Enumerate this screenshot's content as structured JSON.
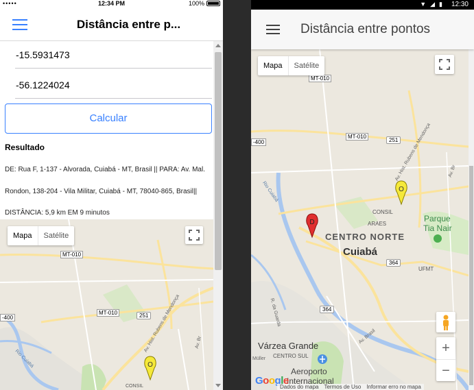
{
  "ios": {
    "status": {
      "carrier": "•••••",
      "time": "12:34 PM",
      "battery": "100%"
    },
    "header": {
      "title": "Distância entre p..."
    },
    "fields": {
      "latitude": "-15.5931473",
      "longitude": "-56.1224024"
    },
    "button": {
      "calculate": "Calcular"
    },
    "result": {
      "title": "Resultado",
      "text": "DE: Rua F, 1-137 - Alvorada, Cuiabá - MT, Brasil || PARA: Av. Mal. Rondon, 138-204 - Vila Militar, Cuiabá - MT, 78040-865, Brasil|| DISTÂNCIA: 5,9 km EM 9 minutos"
    },
    "map": {
      "type_map": "Mapa",
      "type_satellite": "Satélite",
      "labels": {
        "mt010": "MT-010",
        "route400": "-400",
        "mt010b": "MT-010",
        "route251": "251",
        "river": "Rio Cuiabá",
        "avenue": "Av. Hist. Rubens de Mendonça",
        "avbrasil": "Av. Br",
        "consil": "CONSIL"
      },
      "marker_letter": "O"
    }
  },
  "android": {
    "status": {
      "time": "12:30"
    },
    "header": {
      "title": "Distância entre pontos"
    },
    "map": {
      "type_map": "Mapa",
      "type_satellite": "Satélite",
      "labels": {
        "mt010": "MT-010",
        "route400": "-400",
        "mt010b": "MT-010",
        "route251": "251",
        "river": "Rio Cuiabá",
        "avenue": "Av. Hist. Rubens de Mendonça",
        "avbrasil": "Av. Br",
        "consil": "CONSIL",
        "araes": "ARAES",
        "centro_norte": "CENTRO NORTE",
        "cuiaba": "Cuiabá",
        "route364a": "364",
        "route364b": "364",
        "ufmt": "UFMT",
        "parque": "Parque",
        "tianair": "Tia Nair",
        "ruadaguarda": "R. da Guarda",
        "varzea": "Várzea Grande",
        "centrosul": "CENTRO SUL",
        "aeroporto": "Aeroporto",
        "internacional": "Internacional",
        "muller": "Müller",
        "avbrasil2": "Av. Brasil"
      },
      "marker_origin": "O",
      "marker_dest": "D",
      "attribution": {
        "data": "Dados do mapa",
        "terms": "Termos de Uso",
        "report": "Informar erro no mapa"
      },
      "google": "Google"
    }
  }
}
